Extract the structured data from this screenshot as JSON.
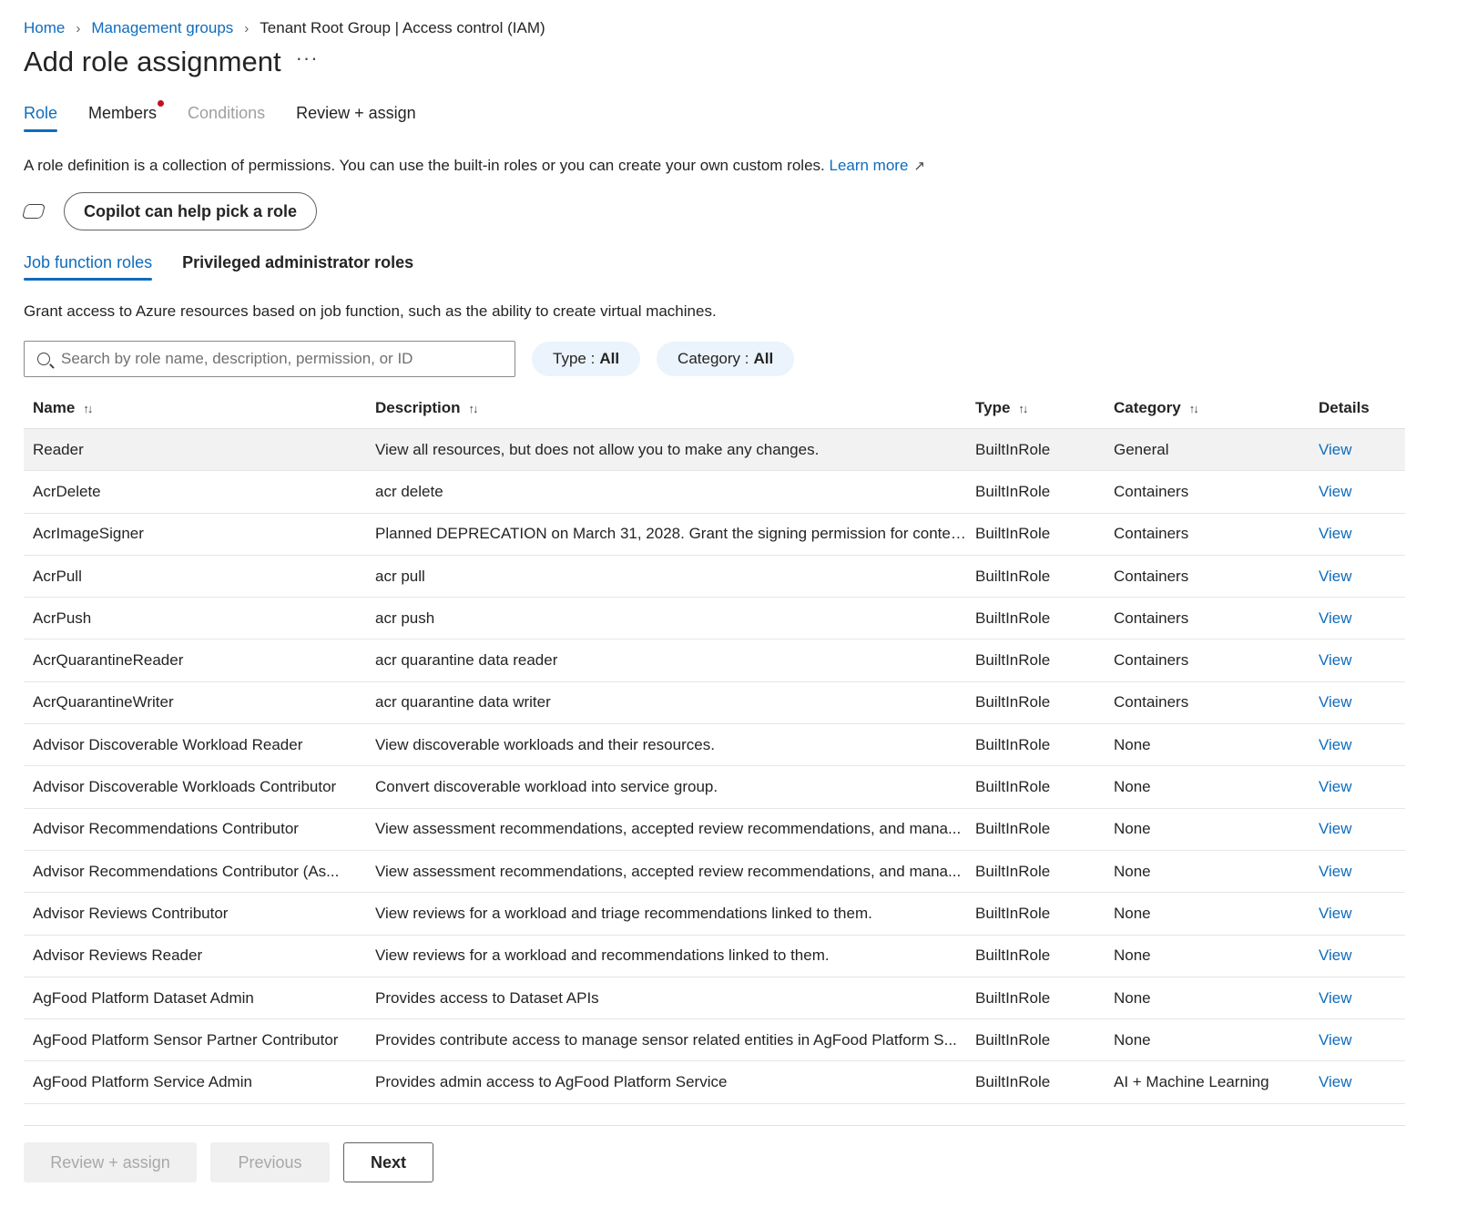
{
  "breadcrumb": {
    "home": "Home",
    "management_groups": "Management groups",
    "current": "Tenant Root Group | Access control (IAM)",
    "separator": "›"
  },
  "page": {
    "title": "Add role assignment",
    "more": "···"
  },
  "tabs": [
    {
      "label": "Role",
      "state": "active"
    },
    {
      "label": "Members",
      "state": "normal",
      "has_dot": true
    },
    {
      "label": "Conditions",
      "state": "disabled"
    },
    {
      "label": "Review + assign",
      "state": "normal"
    }
  ],
  "description": {
    "text": "A role definition is a collection of permissions. You can use the built-in roles or you can create your own custom roles.",
    "learn_more": "Learn more",
    "external_icon": "↗"
  },
  "copilot": {
    "button_label": "Copilot can help pick a role",
    "icon": "copilot-icon"
  },
  "subtabs": [
    {
      "label": "Job function roles",
      "state": "active"
    },
    {
      "label": "Privileged administrator roles",
      "state": "normal"
    }
  ],
  "grant_text": "Grant access to Azure resources based on job function, such as the ability to create virtual machines.",
  "search": {
    "placeholder": "Search by role name, description, permission, or ID",
    "value": ""
  },
  "filters": {
    "type_label": "Type :",
    "type_value": "All",
    "category_label": "Category :",
    "category_value": "All"
  },
  "table": {
    "headers": {
      "name": "Name",
      "description": "Description",
      "type": "Type",
      "category": "Category",
      "details": "Details",
      "sort_icon": "↑↓"
    },
    "rows": [
      {
        "name": "Reader",
        "description": "View all resources, but does not allow you to make any changes.",
        "type": "BuiltInRole",
        "category": "General",
        "details": "View",
        "selected": true
      },
      {
        "name": "AcrDelete",
        "description": "acr delete",
        "type": "BuiltInRole",
        "category": "Containers",
        "details": "View"
      },
      {
        "name": "AcrImageSigner",
        "description": "Planned DEPRECATION on March 31, 2028. Grant the signing permission for conten...",
        "type": "BuiltInRole",
        "category": "Containers",
        "details": "View"
      },
      {
        "name": "AcrPull",
        "description": "acr pull",
        "type": "BuiltInRole",
        "category": "Containers",
        "details": "View"
      },
      {
        "name": "AcrPush",
        "description": "acr push",
        "type": "BuiltInRole",
        "category": "Containers",
        "details": "View"
      },
      {
        "name": "AcrQuarantineReader",
        "description": "acr quarantine data reader",
        "type": "BuiltInRole",
        "category": "Containers",
        "details": "View"
      },
      {
        "name": "AcrQuarantineWriter",
        "description": "acr quarantine data writer",
        "type": "BuiltInRole",
        "category": "Containers",
        "details": "View"
      },
      {
        "name": "Advisor Discoverable Workload Reader",
        "description": "View discoverable workloads and their resources.",
        "type": "BuiltInRole",
        "category": "None",
        "details": "View"
      },
      {
        "name": "Advisor Discoverable Workloads Contributor",
        "description": "Convert discoverable workload into service group.",
        "type": "BuiltInRole",
        "category": "None",
        "details": "View"
      },
      {
        "name": "Advisor Recommendations Contributor",
        "description": "View assessment recommendations, accepted review recommendations, and mana...",
        "type": "BuiltInRole",
        "category": "None",
        "details": "View"
      },
      {
        "name": "Advisor Recommendations Contributor (As...",
        "description": "View assessment recommendations, accepted review recommendations, and mana...",
        "type": "BuiltInRole",
        "category": "None",
        "details": "View"
      },
      {
        "name": "Advisor Reviews Contributor",
        "description": "View reviews for a workload and triage recommendations linked to them.",
        "type": "BuiltInRole",
        "category": "None",
        "details": "View"
      },
      {
        "name": "Advisor Reviews Reader",
        "description": "View reviews for a workload and recommendations linked to them.",
        "type": "BuiltInRole",
        "category": "None",
        "details": "View"
      },
      {
        "name": "AgFood Platform Dataset Admin",
        "description": "Provides access to Dataset APIs",
        "type": "BuiltInRole",
        "category": "None",
        "details": "View"
      },
      {
        "name": "AgFood Platform Sensor Partner Contributor",
        "description": "Provides contribute access to manage sensor related entities in AgFood Platform S...",
        "type": "BuiltInRole",
        "category": "None",
        "details": "View"
      },
      {
        "name": "AgFood Platform Service Admin",
        "description": "Provides admin access to AgFood Platform Service",
        "type": "BuiltInRole",
        "category": "AI + Machine Learning",
        "details": "View"
      }
    ]
  },
  "footer": {
    "review_assign": "Review + assign",
    "previous": "Previous",
    "next": "Next"
  },
  "colors": {
    "accent": "#0f6cbd",
    "notification_dot": "#c50f1f",
    "selected_row": "#f2f2f2",
    "pill_bg": "#ebf3fc"
  }
}
